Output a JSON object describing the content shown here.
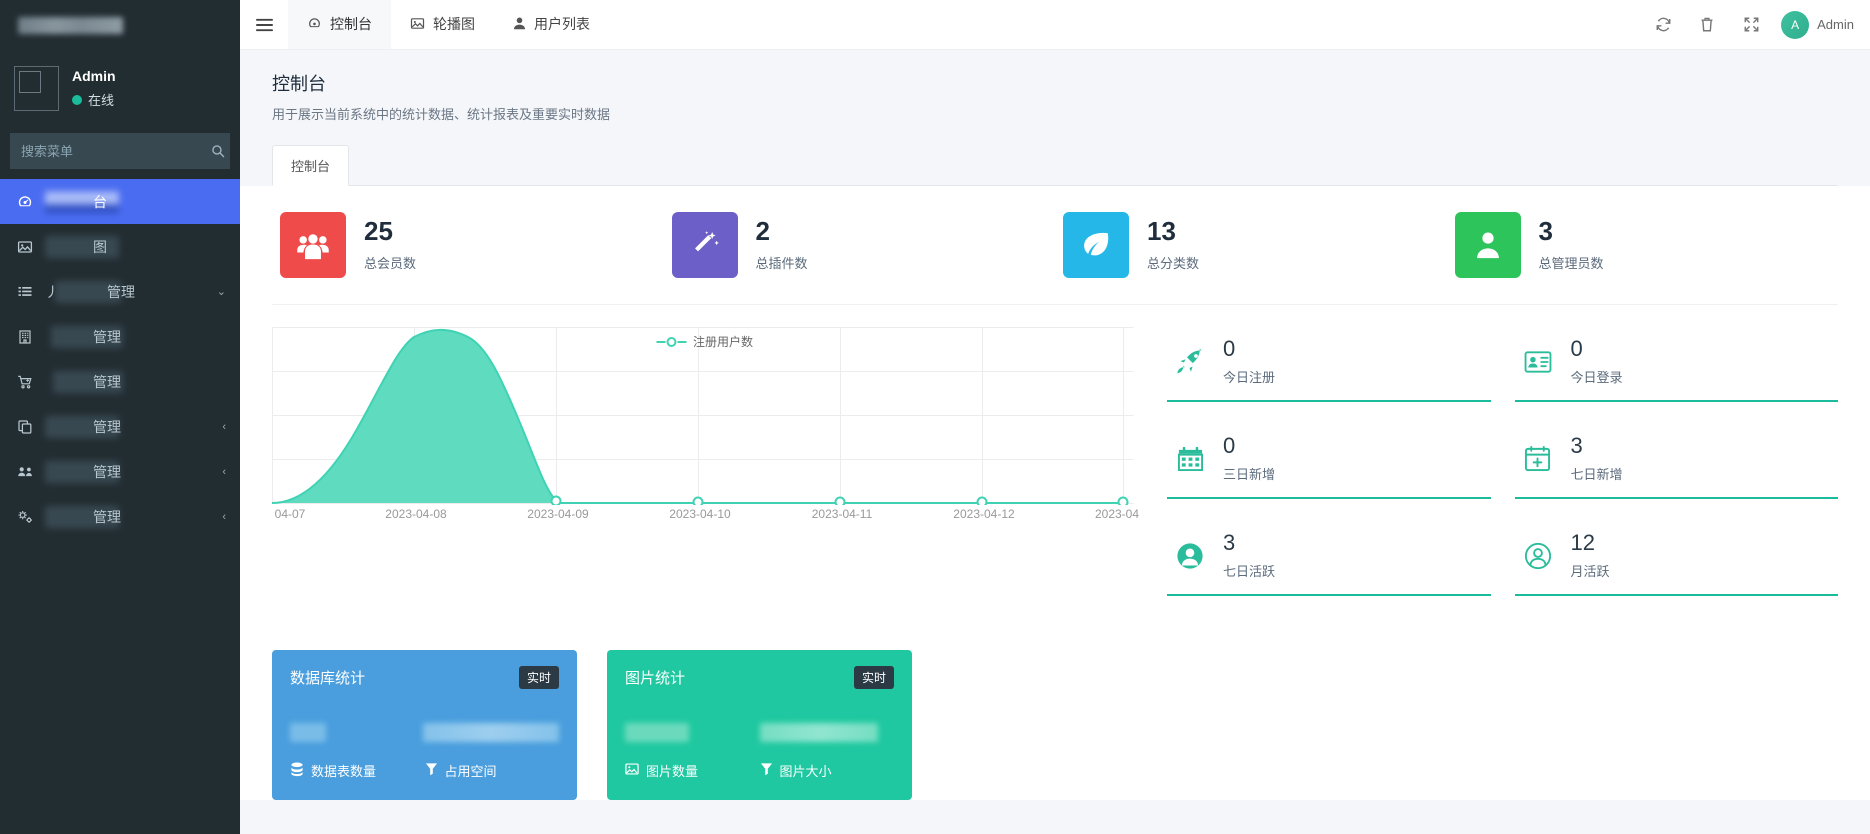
{
  "sidebar": {
    "brand_redacted": true,
    "user": {
      "name": "Admin",
      "status": "在线"
    },
    "search": {
      "placeholder": "搜索菜单",
      "value": ""
    },
    "items": [
      {
        "icon": "dashboard-icon",
        "label_visible": "台",
        "redacted": true,
        "active": true,
        "caret": ""
      },
      {
        "icon": "image-icon",
        "label_visible": "图",
        "redacted": true,
        "active": false,
        "caret": ""
      },
      {
        "icon": "list-icon",
        "label_visible": "管理",
        "redacted": true,
        "active": false,
        "caret": "⌄"
      },
      {
        "icon": "building-icon",
        "label_visible": "管理",
        "redacted": true,
        "active": false,
        "caret": ""
      },
      {
        "icon": "cart-icon",
        "label_visible": "管理",
        "redacted": true,
        "active": false,
        "caret": ""
      },
      {
        "icon": "copy-icon",
        "label_visible": "管理",
        "redacted": true,
        "active": false,
        "caret": "‹"
      },
      {
        "icon": "users-icon",
        "label_visible": "管理",
        "redacted": true,
        "active": false,
        "caret": "‹"
      },
      {
        "icon": "gears-icon",
        "label_visible": "管理",
        "redacted": true,
        "active": false,
        "caret": "‹"
      }
    ]
  },
  "topbar": {
    "menu_toggle": "hamburger-icon",
    "tabs": [
      {
        "icon": "dashboard-icon",
        "label": "控制台",
        "active": true
      },
      {
        "icon": "image-icon",
        "label": "轮播图",
        "active": false
      },
      {
        "icon": "user-icon",
        "label": "用户列表",
        "active": false
      }
    ],
    "actions": [
      {
        "icon": "refresh-icon"
      },
      {
        "icon": "trash-icon"
      },
      {
        "icon": "expand-icon"
      }
    ],
    "user_label": "Admin",
    "user_initial": "A"
  },
  "page": {
    "title": "控制台",
    "subtitle": "用于展示当前系统中的统计数据、统计报表及重要实时数据",
    "tab_label": "控制台"
  },
  "stats": [
    {
      "value": "25",
      "label": "总会员数",
      "icon": "group-icon",
      "color": "#ef4b4b"
    },
    {
      "value": "2",
      "label": "总插件数",
      "icon": "magic-icon",
      "color": "#6c5fc7"
    },
    {
      "value": "13",
      "label": "总分类数",
      "icon": "leaf-icon",
      "color": "#25b7e8"
    },
    {
      "value": "3",
      "label": "总管理员数",
      "icon": "person-icon",
      "color": "#2ec45c"
    }
  ],
  "chart_data": {
    "type": "area",
    "title": "",
    "legend": [
      "注册用户数"
    ],
    "legend_position": "top-center",
    "x": [
      "04-07",
      "2023-04-08",
      "2023-04-09",
      "2023-04-10",
      "2023-04-11",
      "2023-04-12",
      "2023-04"
    ],
    "series": [
      {
        "name": "注册用户数",
        "values": [
          0,
          25,
          0,
          0,
          0,
          0,
          0
        ]
      }
    ],
    "ylim": [
      0,
      28
    ],
    "grid": true,
    "line_color": "#3fd3b3",
    "fill_color": "#5fdcc0"
  },
  "mini_stats": [
    {
      "value": "0",
      "label": "今日注册",
      "icon": "rocket-icon"
    },
    {
      "value": "0",
      "label": "今日登录",
      "icon": "id-card-icon"
    },
    {
      "value": "0",
      "label": "三日新增",
      "icon": "calendar-icon"
    },
    {
      "value": "3",
      "label": "七日新增",
      "icon": "calendar-plus-icon"
    },
    {
      "value": "3",
      "label": "七日活跃",
      "icon": "user-circle-icon"
    },
    {
      "value": "12",
      "label": "月活跃",
      "icon": "user-circle-outline-icon"
    }
  ],
  "info_cards": [
    {
      "title": "数据库统计",
      "badge": "实时",
      "color": "#4a9edd",
      "footer": [
        {
          "icon": "database-icon",
          "label": "数据表数量"
        },
        {
          "icon": "filter-icon",
          "label": "占用空间"
        }
      ]
    },
    {
      "title": "图片统计",
      "badge": "实时",
      "color": "#1fc8a0",
      "footer": [
        {
          "icon": "picture-icon",
          "label": "图片数量"
        },
        {
          "icon": "filter-icon",
          "label": "图片大小"
        }
      ]
    }
  ]
}
